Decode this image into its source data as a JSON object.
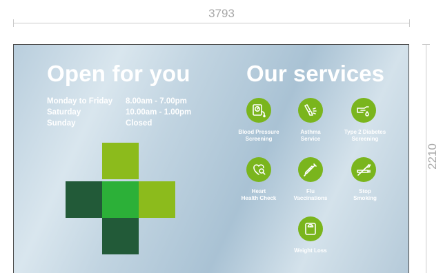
{
  "dimensions": {
    "width_label": "3793",
    "height_label": "2210"
  },
  "sign": {
    "open_title": "Open for you",
    "services_title": "Our services",
    "hours": [
      {
        "day": "Monday to Friday",
        "time": "8.00am  -  7.00pm"
      },
      {
        "day": "Saturday",
        "time": "10.00am - 1.00pm"
      },
      {
        "day": "Sunday",
        "time": "Closed"
      }
    ],
    "services": [
      {
        "line1": "Blood Pressure",
        "line2": "Screening",
        "icon": "blood-pressure-icon"
      },
      {
        "line1": "Asthma",
        "line2": "Service",
        "icon": "inhaler-icon"
      },
      {
        "line1": "Type 2 Diabetes",
        "line2": "Screening",
        "icon": "diabetes-icon"
      },
      {
        "line1": "Heart",
        "line2": "Health Check",
        "icon": "heart-icon"
      },
      {
        "line1": "Flu",
        "line2": "Vaccinations",
        "icon": "syringe-icon"
      },
      {
        "line1": "Stop",
        "line2": "Smoking",
        "icon": "no-smoking-icon"
      },
      {
        "line1": "Weight Loss",
        "line2": "",
        "icon": "scale-icon"
      }
    ],
    "colors": {
      "cross_light_green": "#8cbb1c",
      "cross_center_green": "#2cb038",
      "cross_dark_green": "#225a38",
      "icon_green": "#7ab51d"
    }
  }
}
